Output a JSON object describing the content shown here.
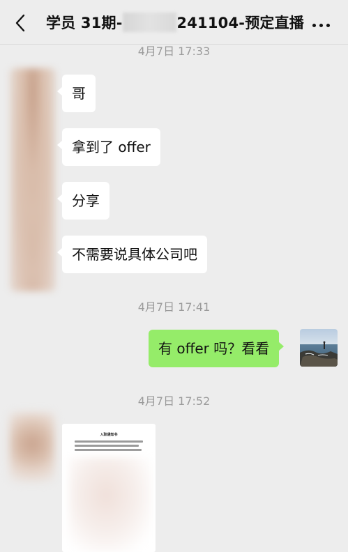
{
  "header": {
    "back_icon": "chevron-left-icon",
    "title_prefix": "学员 31期-",
    "title_suffix": "241104-预定直播",
    "more_icon": "ellipsis-icon"
  },
  "messages": {
    "timestamp_1": "4月7日 17:33",
    "msg_1": "哥",
    "msg_2": "拿到了 offer",
    "msg_3": "分享",
    "msg_4": "不需要说具体公司吧",
    "timestamp_2": "4月7日 17:41",
    "msg_5": "有 offer 吗？看看",
    "timestamp_3": "4月7日 17:52"
  },
  "document": {
    "title": "入职通知书"
  },
  "colors": {
    "background": "#EDEDED",
    "incoming_bubble": "#FFFFFF",
    "outgoing_bubble": "#95EC69",
    "timestamp_text": "#9B9B9B"
  }
}
